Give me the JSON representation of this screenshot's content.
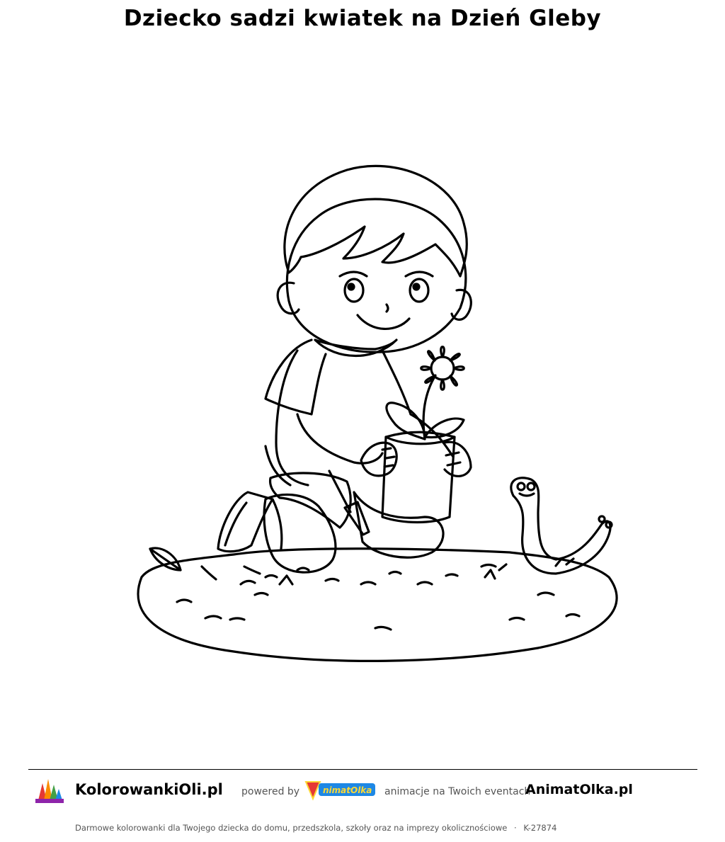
{
  "page": {
    "title": "Dziecko sadzi kwiatek na Dzień Gleby"
  },
  "footer_bar": {
    "brand": "KolorowankiOli.pl",
    "powered_by": "powered by",
    "partner_logo_icon": "animatolka-logo-icon",
    "partner_tagline": "animacje na Twoich eventach",
    "partner_brand": "AnimatOlka.pl",
    "left_logo_icon": "kolorowankioli-logo-icon"
  },
  "footer": {
    "description": "Darmowe kolorowanki dla Twojego dziecka do domu, przedszkola, szkoły oraz na imprezy okolicznościowe",
    "separator": "·",
    "code": "K-27874"
  },
  "illustration": {
    "icon": "child-planting-flower-coloring-icon"
  }
}
